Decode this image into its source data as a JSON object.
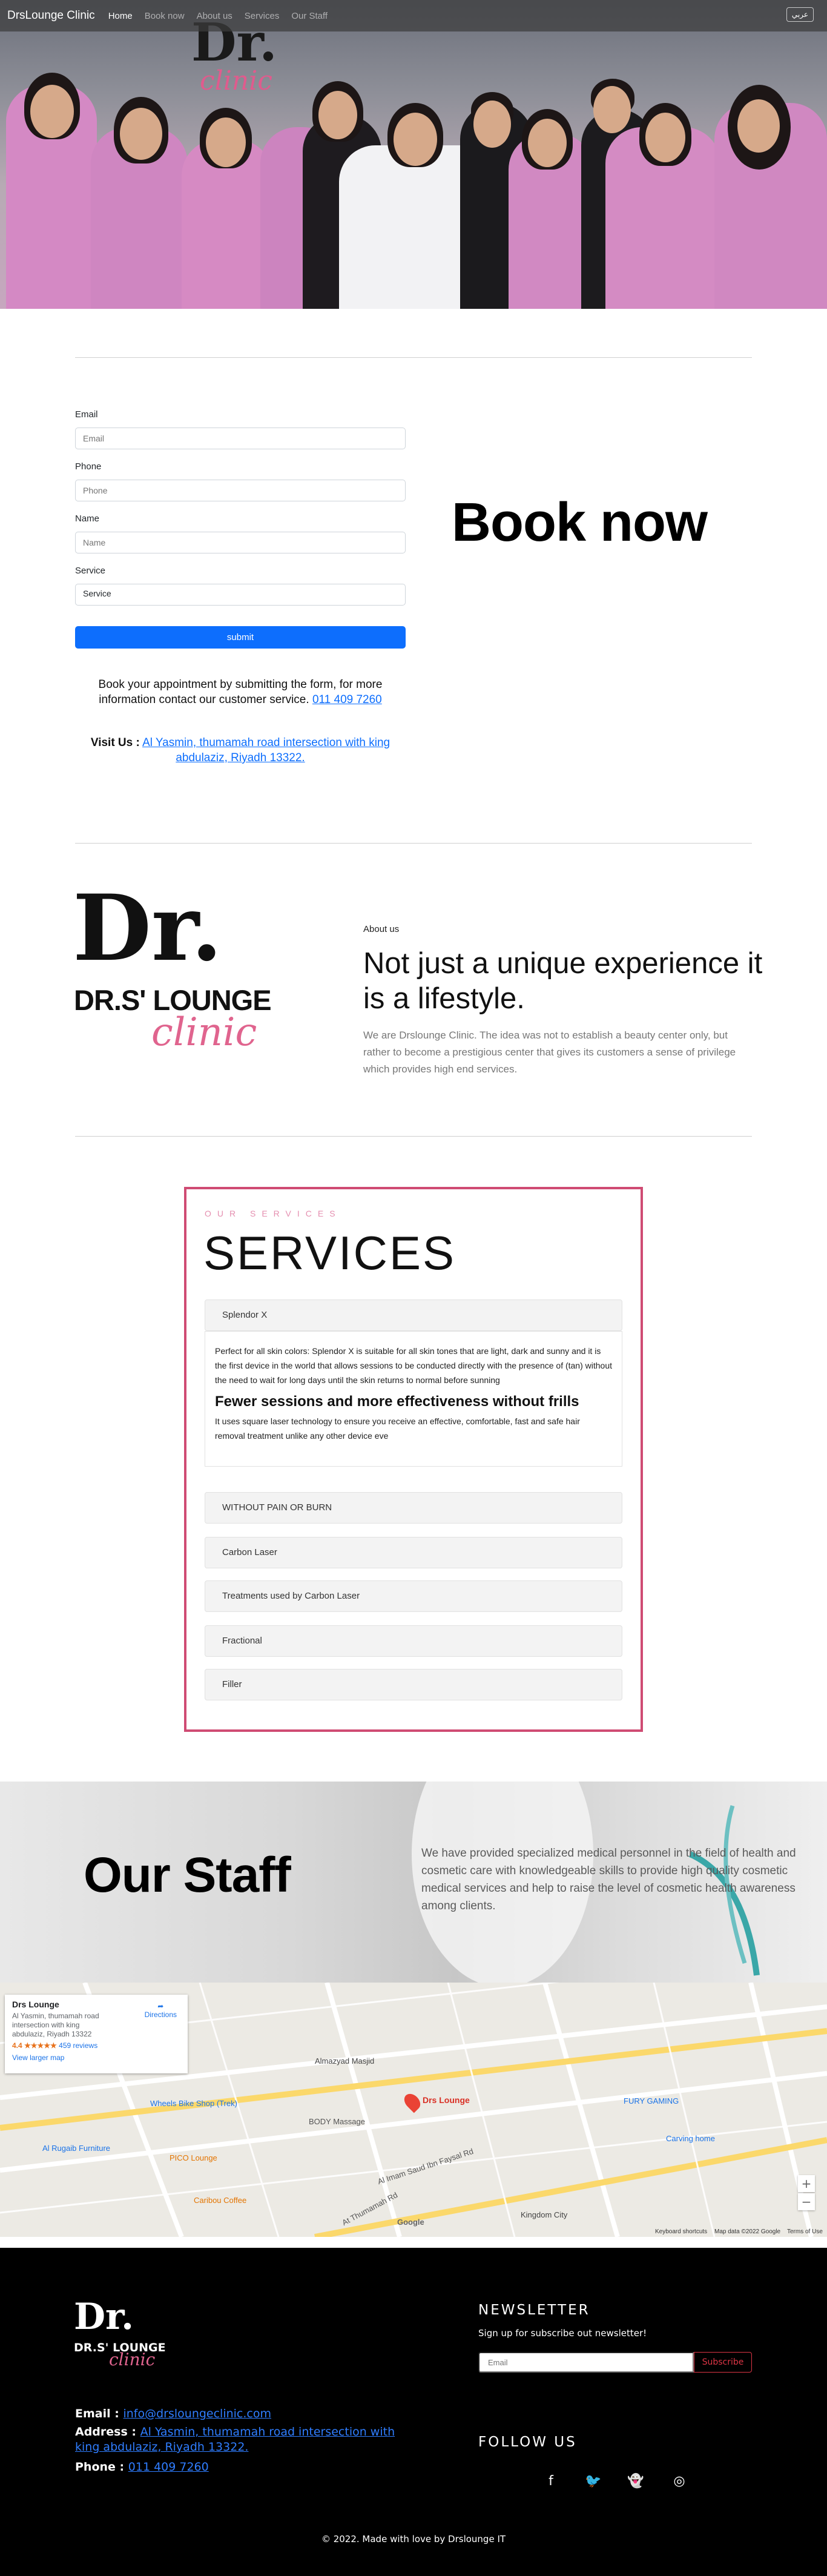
{
  "nav": {
    "brand": "DrsLounge Clinic",
    "links": [
      "Home",
      "Book now",
      "About us",
      "Services",
      "Our Staff"
    ],
    "lang": "عربي"
  },
  "hero": {
    "logo_mark": "Dr.",
    "logo_script": "clinic"
  },
  "booking": {
    "email_label": "Email",
    "email_placeholder": "Email",
    "phone_label": "Phone",
    "phone_placeholder": "Phone",
    "name_label": "Name",
    "name_placeholder": "Name",
    "service_label": "Service",
    "service_value": "Service",
    "submit": "submit",
    "info_text": "Book your appointment by submitting the form, for more information contact our customer service.",
    "phone_link": "011 409 7260",
    "visit_label": "Visit Us :",
    "address_link": "Al Yasmin, thumamah road intersection with king abdulaziz, Riyadh 13322.",
    "title": "Book now"
  },
  "about": {
    "logo_mark": "Dr.",
    "logo_text": "DR.S' LOUNGE",
    "logo_script": "clinic",
    "label": "About us",
    "heading": "Not just a unique experience it is a lifestyle.",
    "text": "We are Drslounge Clinic. The idea was not to establish a beauty center only, but rather to become a prestigious center that gives its customers a sense of privilege which provides high end services."
  },
  "services": {
    "kicker": "OUR SERVICES",
    "title": "SERVICES",
    "items": [
      "Splendor X",
      "WITHOUT PAIN OR BURN",
      "Carbon Laser",
      "Treatments used by Carbon Laser",
      "Fractional",
      "Filler"
    ],
    "open_body": {
      "p1": "Perfect for all skin colors: Splendor X is suitable for all skin tones that are light, dark and sunny and it is the first device in the world that allows sessions to be conducted directly with the presence of (tan) without the need to wait for long days until the skin returns to normal before sunning",
      "h": "Fewer sessions and more effectiveness without frills",
      "p2": "It uses square laser technology to ensure you receive an effective, comfortable, fast and safe hair removal treatment unlike any other device eve"
    }
  },
  "staff": {
    "title": "Our Staff",
    "text": "We have provided specialized medical personnel in the field of health and cosmetic care with knowledgeable skills to provide high quality cosmetic medical services and help to raise the level of cosmetic health awareness among clients."
  },
  "map": {
    "card_name": "Drs Lounge",
    "card_address": "Al Yasmin, thumamah road intersection with king abdulaziz, Riyadh 13322",
    "rating": "4.4 ★★★★★",
    "reviews": "459 reviews",
    "larger": "View larger map",
    "directions": "Directions",
    "pin": "Drs Lounge",
    "labels": {
      "almazyad": "Almazyad Masjid",
      "wheels": "Wheels Bike Shop (Trek)",
      "body": "BODY Massage",
      "rugaib": "Al Rugaib Furniture",
      "pico": "PICO Lounge",
      "caribou": "Caribou Coffee",
      "fury": "FURY GAMING",
      "carving": "Carving home",
      "kingdom": "Kingdom City",
      "road": "Al Imam Saud Ibn Faysal Rd",
      "thumamah": "At Thumamah Rd",
      "google": "Google"
    },
    "footer": [
      "Keyboard shortcuts",
      "Map data ©2022 Google",
      "Terms of Use"
    ]
  },
  "footer": {
    "logo_mark": "Dr.",
    "logo_text": "DR.S' LOUNGE",
    "logo_script": "clinic",
    "email_label": "Email :",
    "email": "info@drsloungeclinic.com",
    "address_label": "Address :",
    "address": "Al Yasmin, thumamah road intersection with king abdulaziz, Riyadh 13322.",
    "phone_label": "Phone :",
    "phone": "011 409 7260",
    "news_title": "NEWSLETTER",
    "news_sub": "Sign up for subscribe out newsletter!",
    "news_placeholder": "Email",
    "subscribe": "Subscribe",
    "follow": "FOLLOW US",
    "social_icons": [
      "facebook-icon",
      "twitter-icon",
      "snapchat-icon",
      "instagram-icon"
    ],
    "copyright": "© 2022. Made with love by Drslounge IT"
  }
}
